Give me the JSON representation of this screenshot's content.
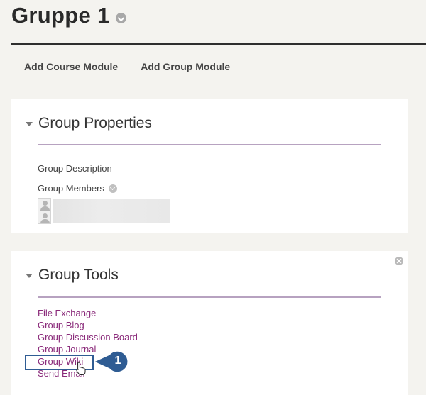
{
  "header": {
    "title": "Gruppe 1",
    "title_menu_icon": "chevron-down-circle-icon"
  },
  "actions": {
    "add_course_module": "Add Course Module",
    "add_group_module": "Add Group Module"
  },
  "group_properties": {
    "title": "Group Properties",
    "description_label": "Group Description",
    "members_label": "Group Members"
  },
  "group_tools": {
    "title": "Group Tools",
    "items": [
      {
        "label": "File Exchange"
      },
      {
        "label": "Group Blog"
      },
      {
        "label": "Group Discussion Board"
      },
      {
        "label": "Group Journal"
      },
      {
        "label": "Group Wiki"
      },
      {
        "label": "Send Email"
      }
    ]
  },
  "callout": {
    "number": "1",
    "color": "#2f5c93"
  },
  "colors": {
    "link": "#8a2a7a",
    "accent_rule": "#b7a2c0",
    "background": "#f4f3ef"
  }
}
